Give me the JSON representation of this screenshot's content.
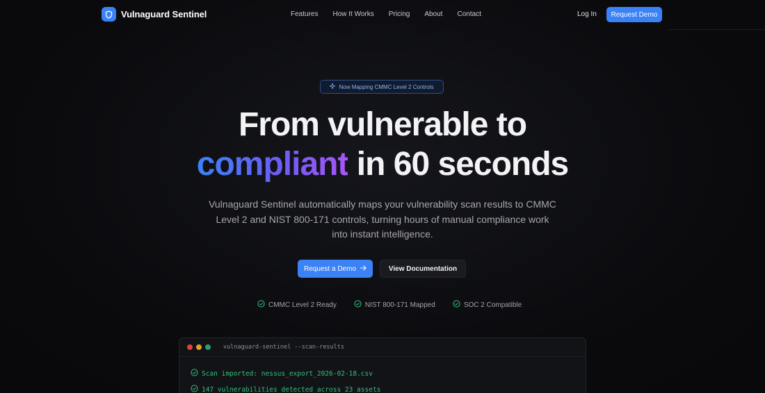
{
  "brand": {
    "name": "Vulnaguard Sentinel",
    "accent": "#3b82f6"
  },
  "nav": {
    "links": [
      "Features",
      "How It Works",
      "Pricing",
      "About",
      "Contact"
    ],
    "login": "Log In",
    "cta": "Request Demo"
  },
  "hero": {
    "badge": "Now Mapping CMMC Level 2 Controls",
    "headline_line1": "From vulnerable to",
    "headline_highlight": "compliant",
    "headline_line2_rest": " in 60 seconds",
    "subtitle": "Vulnaguard Sentinel automatically maps your vulnerability scan results to CMMC Level 2 and NIST 800-171 controls, turning hours of manual compliance work into instant intelligence.",
    "primary_button": "Request a Demo",
    "secondary_button": "View Documentation",
    "checks": [
      "CMMC Level 2 Ready",
      "NIST 800-171 Mapped",
      "SOC 2 Compatible"
    ]
  },
  "terminal": {
    "title": "vulnaguard-sentinel --scan-results",
    "lines": [
      "Scan imported: nessus_export_2026-02-18.csv",
      "147 vulnerabilities detected across 23 assets"
    ],
    "dot_colors": [
      "#e0443e",
      "#dea123",
      "#27a06b"
    ]
  },
  "colors": {
    "success": "#34c07a",
    "gradient": [
      "#3b82f6",
      "#a855f7"
    ]
  }
}
